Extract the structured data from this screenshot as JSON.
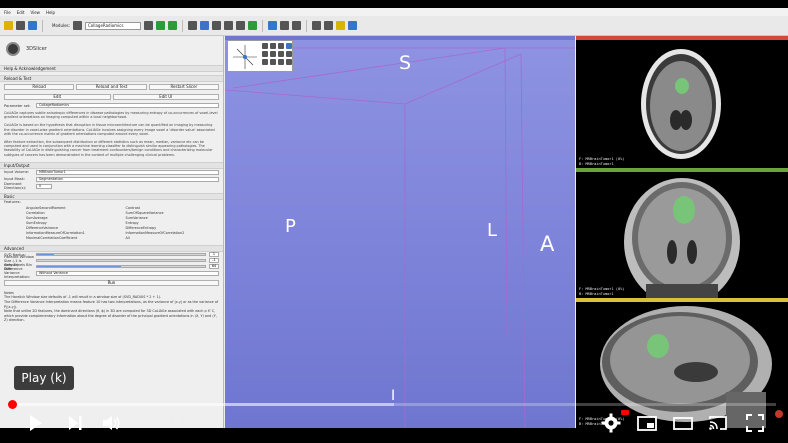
{
  "menu": [
    "File",
    "Edit",
    "View",
    "Help"
  ],
  "toolbar": {
    "modules_label": "Modules:",
    "module_selected": "CollageRadiomics"
  },
  "panel": {
    "logo_text": "3DSlicer",
    "help_section": "Help & Acknowledgement",
    "reload_section": "Reload & Test",
    "buttons_row1": [
      "Reload",
      "Reload and Test",
      "Restart Slicer"
    ],
    "buttons_row2": [
      "Edit",
      "Edit UI"
    ],
    "param_label": "Parameter set:",
    "param_value": "CollageRadiomics",
    "description_1": "CoLlAGe captures subtle anisotropic differences in disease pathologies by measuring entropy of co-occurrences of voxel-level gradient orientations on imaging computed within a local neighborhood.",
    "description_2": "CoLlAGe is based on the hypothesis that disruption in tissue microarchitecture can be quantified on imaging by measuring the disorder in voxel-wise gradient orientations. CoLlAGe involves assigning every image voxel a 'disorder value' associated with the co-occurrence matrix of gradient orientations computed around every voxel.",
    "description_3": "After feature extraction, the subsequent distribution or different statistics such as mean, median, variance etc can be computed and used in conjunction with a machine learning classifier to distinguish similar appearing pathologies. The feasibility of CoLlAGe in distinguishing cancer from treatment confounders/benign conditions and characterizing molecular subtypes of cancers has been demonstrated in the context of multiple challenging clinical problems.",
    "inputs_section": "Input/Output",
    "input_volume_label": "Input Volume:",
    "input_volume_value": "MRBrainTumor1",
    "input_mask_label": "Input Mask:",
    "input_mask_value": "Segmentation",
    "dominant_label": "Dominant Direction(s):",
    "dominant_value": "0",
    "basic_section": "Basic",
    "features_label": "Features:",
    "features": [
      "AngularSecondMoment",
      "Contrast",
      "Correlation",
      "SumOfSquareVariance",
      "SumAverage",
      "SumVariance",
      "SumEntropy",
      "Entropy",
      "DifferenceVariance",
      "DifferenceEntropy",
      "InformationMeasureOfCorrelation1",
      "InformationMeasureOfCorrelation2",
      "MaximalCorrelationCoefficient",
      "All"
    ],
    "advanced_section": "Advanced",
    "sliders": [
      {
        "label": "SVD Radius:",
        "value": "1",
        "fraction": 0.1
      },
      {
        "label": "Haralick Window Size (-1 is default):",
        "value": "-1",
        "fraction": 0.0
      },
      {
        "label": "Grey Levels Bin Size:",
        "value": "64",
        "fraction": 0.5
      },
      {
        "label": "Difference Variance Interpretation:",
        "value": "Without Variance",
        "fraction": 0
      }
    ],
    "run_label": "Run",
    "notes_title": "Notes",
    "notes_1": "The Haralick Window size defaults of -1 will result in a window size of (SVD_RADIUS * 2 + 1).",
    "notes_2": "The Difference Variance Interpretation means feature 10 has two interpretations, as the variance of |x-y| or as the variance of P(|x-y|).",
    "notes_3": "Note that unlike 2D features, the dominant directions (θ, ϕ) in 3D are computed for 3D CoLlAGe associated with each p ∈ C, which provide complementary information about the degree of disorder of the principal gradient orientations in (X, Y) and (Y, Z) direction."
  },
  "view3d": {
    "orient_s": "S",
    "orient_p": "P",
    "orient_l": "L",
    "orient_a": "A",
    "orient_i": "I"
  },
  "slices": {
    "red_label": "F: MRBrainTumor1 (0%)\nB: MRBrainTumor1",
    "green_label": "F: MRBrainTumor1 (0%)\nB: MRBrainTumor1",
    "yellow_label": "F: MRBrainTumor1 (0%)\nB: MRBrainTumor1"
  },
  "player": {
    "tooltip": "Play (k)",
    "current_time": "0:00",
    "duration": "1:16",
    "progress_fraction": 0.0,
    "buffered_fraction": 0.5
  },
  "colors": {
    "accent_red": "#ff0000",
    "view3d_bg": "#8e93e2",
    "slice_red": "#d14a3c",
    "slice_green": "#6ea33a",
    "slice_yellow": "#d9c23a"
  }
}
